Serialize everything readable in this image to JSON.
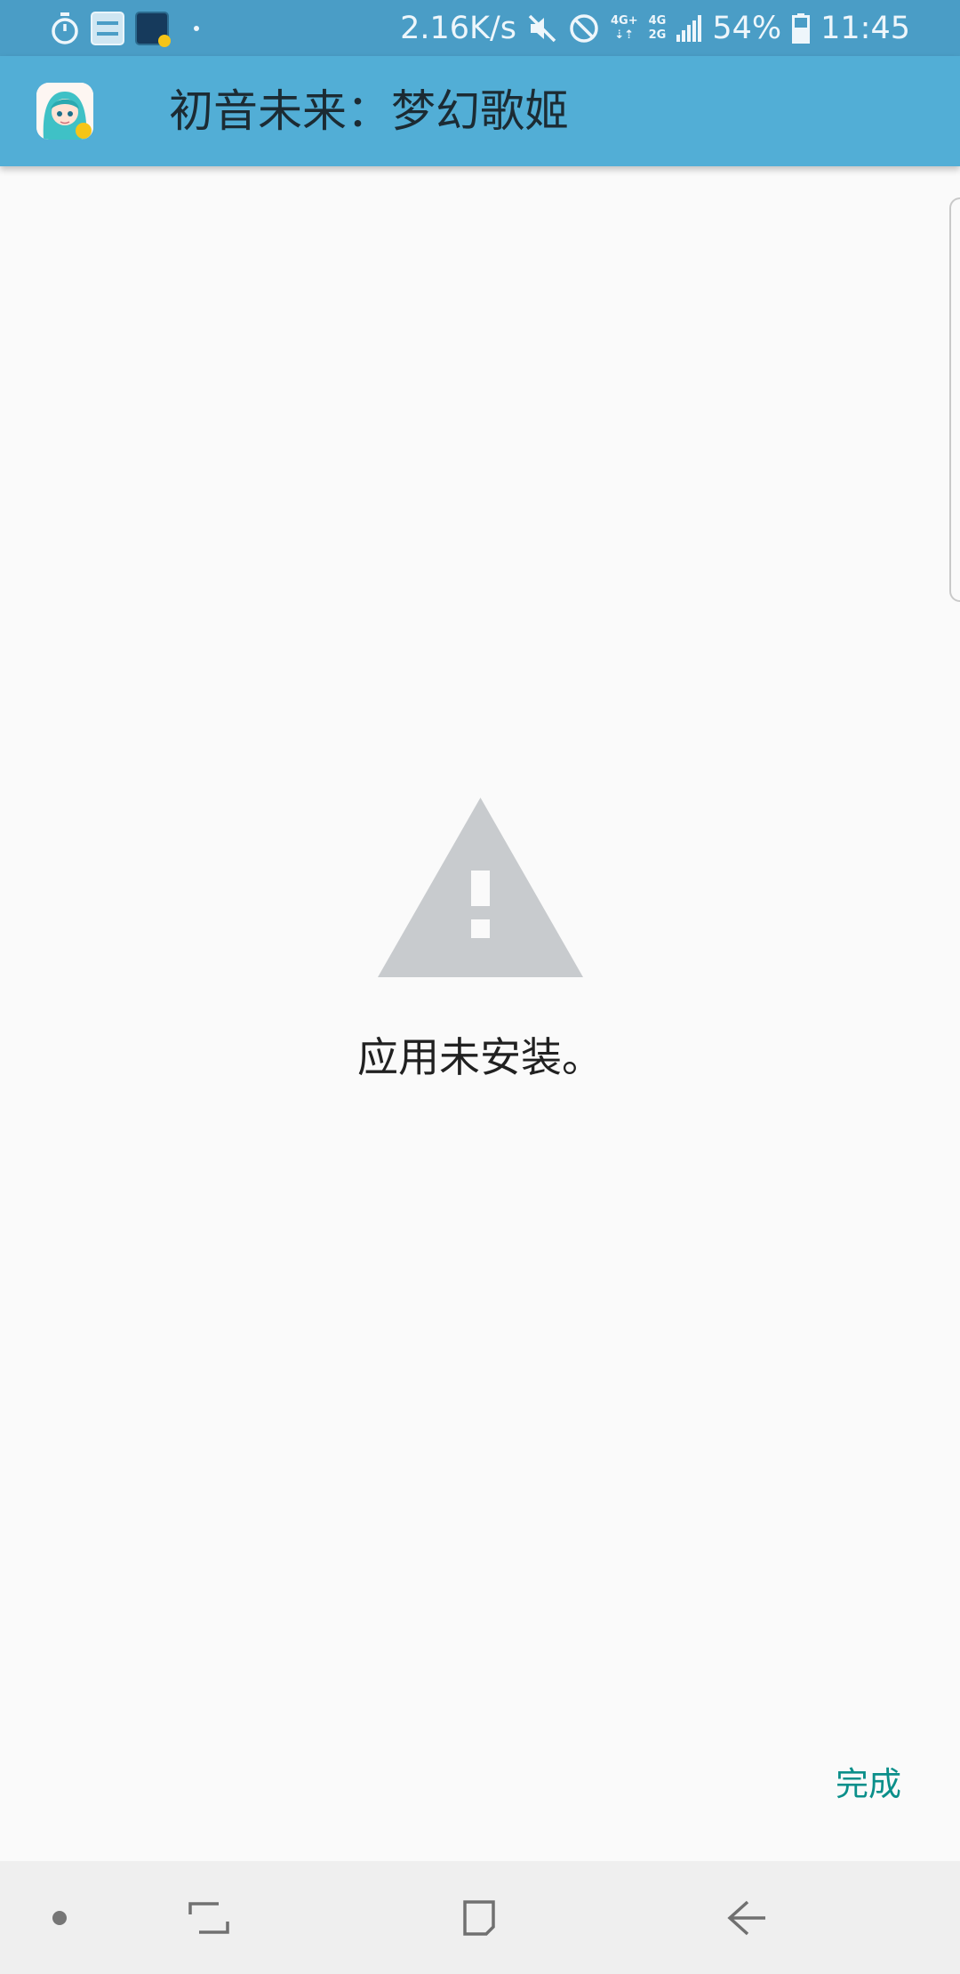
{
  "status_bar": {
    "net_speed": "2.16K/s",
    "network_1": {
      "top": "4G+",
      "bottom": "⇣⇡"
    },
    "network_2": {
      "top": "4G",
      "bottom": "2G"
    },
    "battery_percent": "54%",
    "time": "11:45",
    "notification_icons": [
      "timer-icon",
      "app-notification-icon",
      "game-notification-icon",
      "more-notifications-dot"
    ],
    "system_icons": [
      "mute-icon",
      "do-not-disturb-icon",
      "signal-icon",
      "battery-icon"
    ]
  },
  "header": {
    "app_icon": "hatsune-miku-app-icon",
    "title": "初音未来：梦幻歌姬"
  },
  "content": {
    "icon": "warning-icon",
    "message": "应用未安装。",
    "done_label": "完成"
  },
  "colors": {
    "status_bar": "#4a9dc6",
    "header": "#52aed6",
    "background": "#fafafa",
    "warning_icon": "#c8cbce",
    "done_accent": "#0b8f8a",
    "nav_bar": "#efefef"
  },
  "nav_bar": {
    "buttons": [
      "pin-dot-icon",
      "recents-icon",
      "home-icon",
      "back-icon"
    ]
  }
}
